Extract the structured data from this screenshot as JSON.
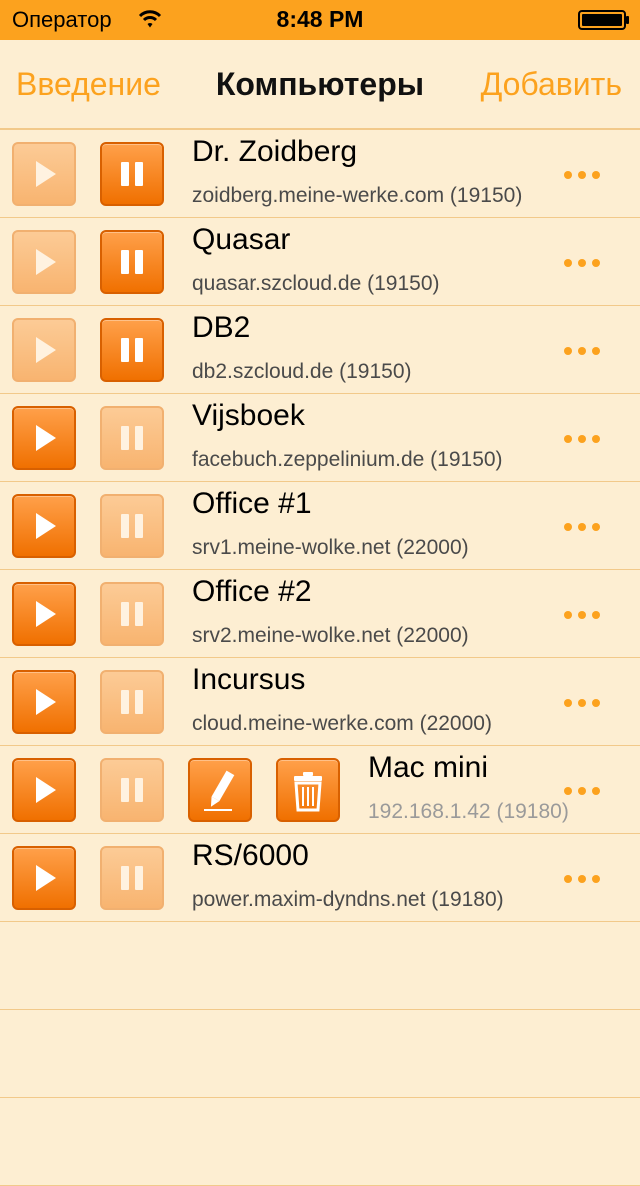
{
  "status_bar": {
    "carrier": "Оператор",
    "time": "8:48 PM"
  },
  "nav": {
    "left_label": "Введение",
    "title": "Компьютеры",
    "right_label": "Добавить"
  },
  "colors": {
    "accent": "#fca21e",
    "background": "#fdeed2",
    "button_active": "#f07000",
    "button_inactive": "#fccb96"
  },
  "computers": [
    {
      "name": "Dr. Zoidberg",
      "host": "zoidberg.meine-werke.com (19150)",
      "state": "running"
    },
    {
      "name": "Quasar",
      "host": "quasar.szcloud.de (19150)",
      "state": "running"
    },
    {
      "name": "DB2",
      "host": "db2.szcloud.de (19150)",
      "state": "running"
    },
    {
      "name": "Vijsboek",
      "host": "facebuch.zeppelinium.de (19150)",
      "state": "paused"
    },
    {
      "name": "Office #1",
      "host": "srv1.meine-wolke.net (22000)",
      "state": "paused"
    },
    {
      "name": "Office #2",
      "host": "srv2.meine-wolke.net (22000)",
      "state": "paused"
    },
    {
      "name": "Incursus",
      "host": "cloud.meine-werke.com (22000)",
      "state": "paused"
    },
    {
      "name": "Mac mini",
      "host": "192.168.1.42 (19180)",
      "state": "paused",
      "editing": true
    },
    {
      "name": "RS/6000",
      "host": "power.maxim-dyndns.net (19180)",
      "state": "paused"
    }
  ],
  "icons": {
    "play": "play-icon",
    "pause": "pause-icon",
    "edit": "pencil-icon",
    "delete": "trash-icon",
    "more": "ellipsis-icon"
  }
}
